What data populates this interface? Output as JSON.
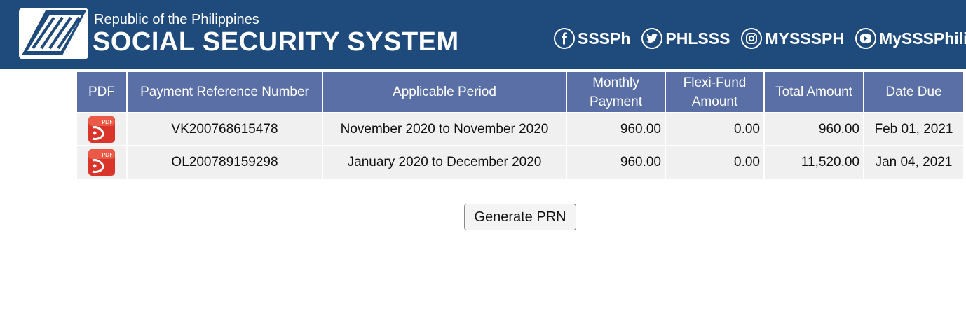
{
  "header": {
    "org_top": "Republic of the Philippines",
    "org_main": "SOCIAL SECURITY SYSTEM",
    "social": [
      {
        "icon": "facebook-icon",
        "label": "SSSPh"
      },
      {
        "icon": "twitter-icon",
        "label": "PHLSSS"
      },
      {
        "icon": "instagram-icon",
        "label": "MYSSSPH"
      },
      {
        "icon": "youtube-icon",
        "label": "MySSSPhilippines"
      }
    ]
  },
  "table": {
    "headers": {
      "pdf": "PDF",
      "prn": "Payment Reference Number",
      "period": "Applicable Period",
      "monthly_line1": "Monthly",
      "monthly_line2": "Payment",
      "flexi_line1": "Flexi-Fund",
      "flexi_line2": "Amount",
      "total": "Total Amount",
      "due": "Date Due"
    },
    "rows": [
      {
        "icon": "pdf-icon",
        "prn": "VK200768615478",
        "period": "November 2020 to November 2020",
        "monthly": "960.00",
        "flexi": "0.00",
        "total": "960.00",
        "due": "Feb 01, 2021"
      },
      {
        "icon": "pdf-icon",
        "prn": "OL200789159298",
        "period": "January 2020 to December 2020",
        "monthly": "960.00",
        "flexi": "0.00",
        "total": "11,520.00",
        "due": "Jan 04, 2021"
      }
    ]
  },
  "actions": {
    "generate_label": "Generate PRN"
  },
  "colors": {
    "header_bg": "#1f4a7c",
    "table_header_bg": "#5b6fa7",
    "row_bg": "#f0f0f0",
    "pdf_red": "#d9352b"
  }
}
